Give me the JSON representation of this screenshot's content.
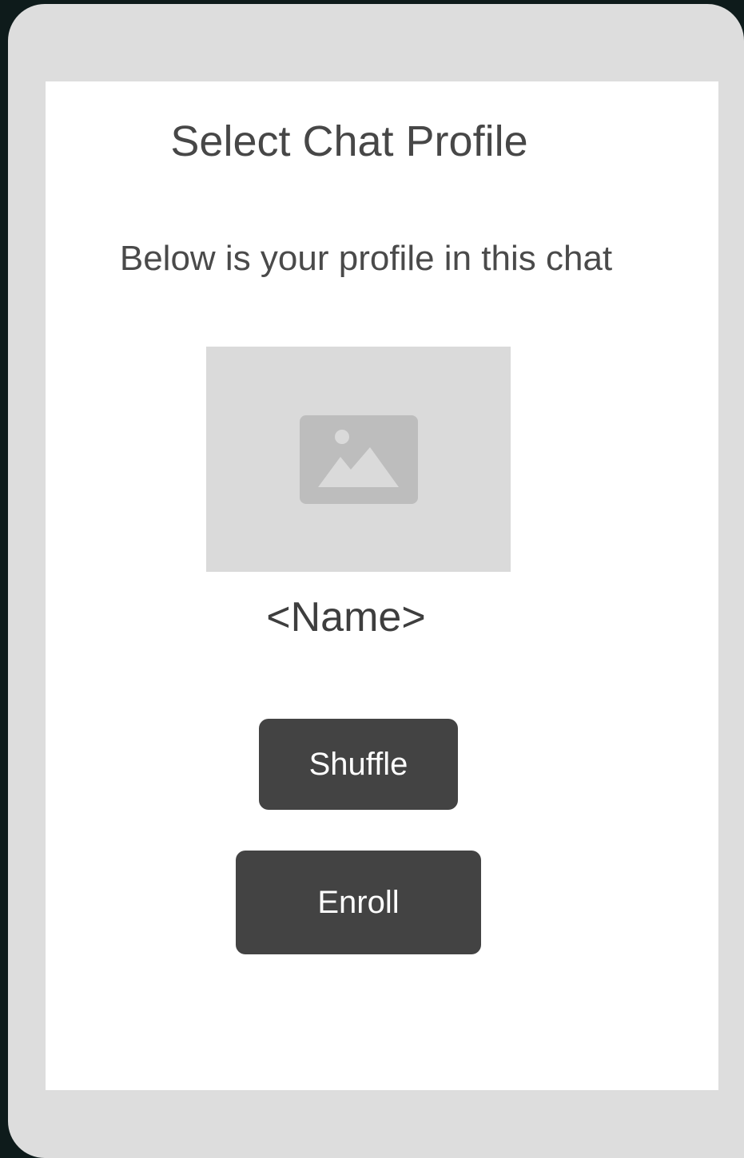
{
  "screen": {
    "title": "Select Chat Profile",
    "subtitle": "Below is your profile in this chat",
    "profile_image_icon": "image-placeholder-icon",
    "profile_name": "<Name>",
    "shuffle_label": "Shuffle",
    "enroll_label": "Enroll"
  },
  "colors": {
    "button_bg": "#434343",
    "button_text": "#ffffff",
    "frame": "#dddddd",
    "placeholder": "#dadada"
  }
}
